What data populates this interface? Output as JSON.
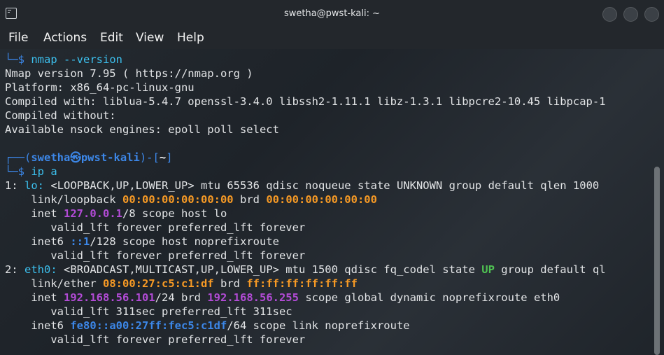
{
  "window": {
    "title": "swetha@pwst-kali: ~"
  },
  "menu": {
    "file": "File",
    "actions": "Actions",
    "edit": "Edit",
    "view": "View",
    "help": "Help"
  },
  "terminal": {
    "cmd1_prompt": "└─$",
    "cmd1": "nmap --version",
    "out1": [
      "Nmap version 7.95 ( https://nmap.org )",
      "Platform: x86_64-pc-linux-gnu",
      "Compiled with: liblua-5.4.7 openssl-3.4.0 libssh2-1.11.1 libz-1.3.1 libpcre2-10.45 libpcap-1",
      "Compiled without:",
      "Available nsock engines: epoll poll select"
    ],
    "prompt2": {
      "open": "┌──(",
      "user": "swetha",
      "at": "㉿",
      "host": "pwst-kali",
      "close": ")-[",
      "dir": "~",
      "end": "]"
    },
    "cmd2_prompt": "└─$",
    "cmd2": "ip a",
    "lo": {
      "idx": "1:",
      "name": "lo:",
      "flags": "<LOOPBACK,UP,LOWER_UP> mtu 65536 qdisc noqueue state UNKNOWN group default qlen 1000",
      "link_label": "link/loopback",
      "mac": "00:00:00:00:00:00",
      "brd_label": "brd",
      "brd_mac": "00:00:00:00:00:00",
      "inet_label": "inet",
      "ip": "127.0.0.1",
      "inet_rest": "/8 scope host lo",
      "valid1": "valid_lft forever preferred_lft forever",
      "inet6_label": "inet6",
      "ip6": "::1",
      "inet6_rest": "/128 scope host noprefixroute",
      "valid2": "valid_lft forever preferred_lft forever"
    },
    "eth0": {
      "idx": "2:",
      "name": "eth0:",
      "flags_a": "<BROADCAST,MULTICAST,UP,LOWER_UP> mtu 1500 qdisc fq_codel state",
      "state": "UP",
      "flags_b": "group default ql",
      "link_label": "link/ether",
      "mac": "08:00:27:c5:c1:df",
      "brd_label": "brd",
      "brd_mac": "ff:ff:ff:ff:ff:ff",
      "inet_label": "inet",
      "ip": "192.168.56.101",
      "inet_mid": "/24 brd",
      "brd_ip": "192.168.56.255",
      "inet_rest": "scope global dynamic noprefixroute eth0",
      "valid1": "valid_lft 311sec preferred_lft 311sec",
      "inet6_label": "inet6",
      "ip6": "fe80::a00:27ff:fec5:c1df",
      "inet6_rest": "/64 scope link noprefixroute",
      "valid2": "valid_lft forever preferred_lft forever"
    }
  }
}
